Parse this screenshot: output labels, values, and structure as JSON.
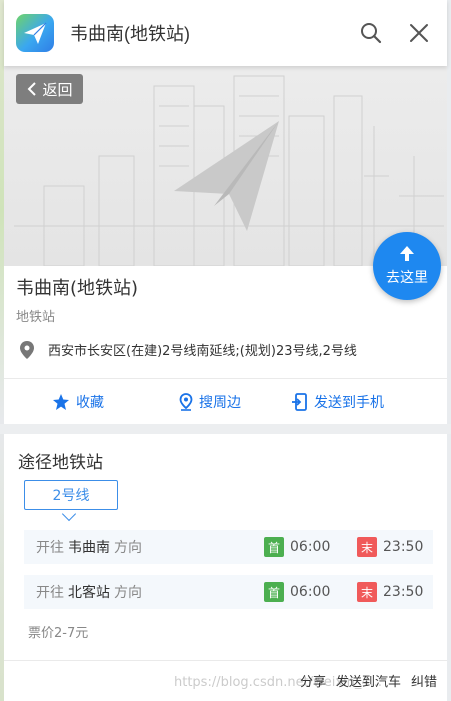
{
  "header": {
    "title": "韦曲南(地铁站)",
    "icons": [
      "search-icon",
      "close-icon"
    ]
  },
  "banner": {
    "back_label": "返回",
    "go_label": "去这里"
  },
  "poi": {
    "name": "韦曲南(地铁站)",
    "type": "地铁站",
    "address": "西安市长安区(在建)2号线南延线;(规划)23号线,2号线"
  },
  "actions": {
    "favorite": "收藏",
    "nearby": "搜周边",
    "send_to_phone": "发送到手机"
  },
  "lines_section": {
    "title": "途径地铁站",
    "active_line": "2号线",
    "directions": [
      {
        "prefix": "开往",
        "station": "韦曲南",
        "suffix": "方向",
        "first_badge": "首",
        "first_time": "06:00",
        "last_badge": "末",
        "last_time": "23:50"
      },
      {
        "prefix": "开往",
        "station": "北客站",
        "suffix": "方向",
        "first_badge": "首",
        "first_time": "06:00",
        "last_badge": "末",
        "last_time": "23:50"
      }
    ],
    "fare": "票价2-7元"
  },
  "footer": {
    "share": "分享",
    "send_to_car": "发送到汽车",
    "correct": "纠错",
    "watermark": "https://blog.csdn.net/weixin_4..."
  },
  "colors": {
    "accent": "#1a73e8",
    "go_button": "#1e88f0",
    "first_badge": "#4caf50",
    "last_badge": "#f05a5a"
  }
}
